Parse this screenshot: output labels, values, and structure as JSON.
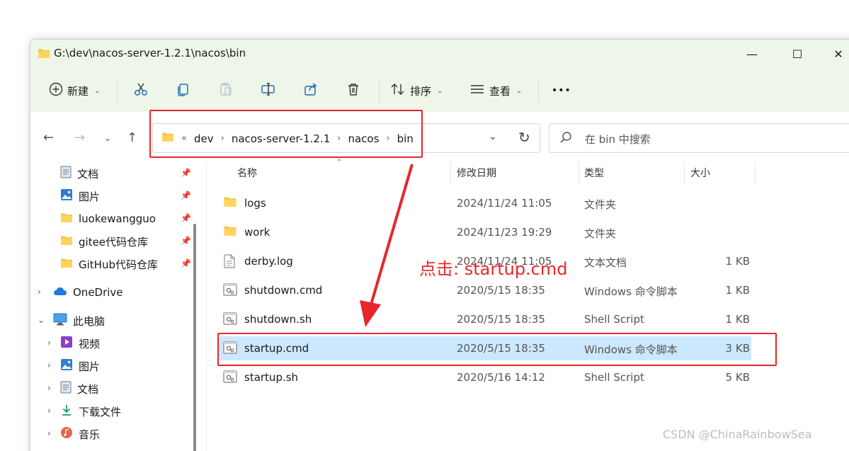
{
  "window": {
    "title": "G:\\dev\\nacos-server-1.2.1\\nacos\\bin",
    "minimize_glyph": "—",
    "maximize_glyph": "☐",
    "close_glyph": "✕"
  },
  "toolbar": {
    "new_label": "新建",
    "sort_label": "排序",
    "view_label": "查看",
    "more_glyph": "•••",
    "icons": [
      "cut-icon",
      "copy-icon",
      "paste-icon",
      "rename-icon",
      "share-icon",
      "delete-icon"
    ]
  },
  "address": {
    "overflow_glyph": "«",
    "crumbs": [
      "dev",
      "nacos-server-1.2.1",
      "nacos",
      "bin"
    ],
    "separator": "›"
  },
  "search": {
    "placeholder": "在 bin 中搜索"
  },
  "sidebar": {
    "pinned": [
      {
        "label": "文档",
        "icon": "document-icon"
      },
      {
        "label": "图片",
        "icon": "pictures-icon"
      },
      {
        "label": "luokewangguo",
        "icon": "folder-icon"
      },
      {
        "label": "gitee代码仓库",
        "icon": "folder-icon"
      },
      {
        "label": "GitHub代码仓库",
        "icon": "folder-icon"
      }
    ],
    "onedrive": "OneDrive",
    "this_pc": "此电脑",
    "pc_items": [
      {
        "label": "视频",
        "icon": "video-icon"
      },
      {
        "label": "图片",
        "icon": "pictures-icon"
      },
      {
        "label": "文档",
        "icon": "document-icon"
      },
      {
        "label": "下载文件",
        "icon": "download-icon"
      },
      {
        "label": "音乐",
        "icon": "music-icon"
      }
    ]
  },
  "columns": {
    "name": "名称",
    "date": "修改日期",
    "type": "类型",
    "size": "大小"
  },
  "files": [
    {
      "name": "logs",
      "date": "2024/11/24 11:05",
      "type": "文件夹",
      "size": "",
      "icon": "folder-icon",
      "selected": false
    },
    {
      "name": "work",
      "date": "2024/11/23 19:29",
      "type": "文件夹",
      "size": "",
      "icon": "folder-icon",
      "selected": false
    },
    {
      "name": "derby.log",
      "date": "2024/11/24 11:05",
      "type": "文本文档",
      "size": "1 KB",
      "icon": "text-file-icon",
      "selected": false
    },
    {
      "name": "shutdown.cmd",
      "date": "2020/5/15 18:35",
      "type": "Windows 命令脚本",
      "size": "1 KB",
      "icon": "script-file-icon",
      "selected": false
    },
    {
      "name": "shutdown.sh",
      "date": "2020/5/15 18:35",
      "type": "Shell Script",
      "size": "1 KB",
      "icon": "script-file-icon",
      "selected": false
    },
    {
      "name": "startup.cmd",
      "date": "2020/5/15 18:35",
      "type": "Windows 命令脚本",
      "size": "3 KB",
      "icon": "script-file-icon",
      "selected": true
    },
    {
      "name": "startup.sh",
      "date": "2020/5/16 14:12",
      "type": "Shell Script",
      "size": "5 KB",
      "icon": "script-file-icon",
      "selected": false
    }
  ],
  "annotation": {
    "text": "点击: startup.cmd",
    "color": "#e8262b"
  },
  "watermark": "CSDN @ChinaRainbowSea",
  "colors": {
    "chrome_bg": "#eef6ea",
    "selection": "#cce8ff",
    "folder": "#f4c542",
    "annotation": "#e8262b"
  }
}
